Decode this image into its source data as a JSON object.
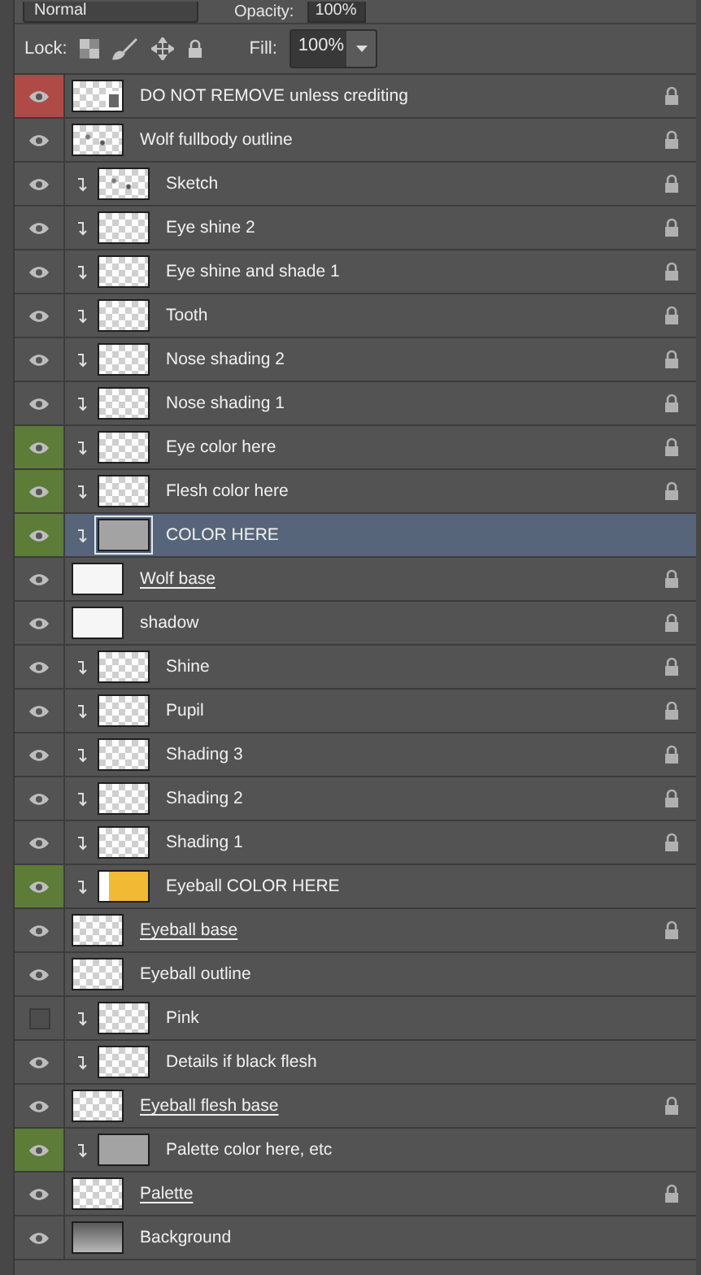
{
  "blend_mode": {
    "value": "Normal"
  },
  "opacity": {
    "label": "Opacity:",
    "value": "100%"
  },
  "lock": {
    "label": "Lock:"
  },
  "fill": {
    "label": "Fill:",
    "value": "100%"
  },
  "layers": [
    {
      "name": "DO NOT REMOVE unless crediting",
      "visible": true,
      "color": "#b04a46",
      "clipped": false,
      "locked": true,
      "underlined": false,
      "kind": "smart",
      "selected": false
    },
    {
      "name": "Wolf fullbody outline",
      "visible": true,
      "clipped": false,
      "locked": true,
      "underlined": false,
      "kind": "sketch",
      "selected": false
    },
    {
      "name": "Sketch",
      "visible": true,
      "clipped": true,
      "locked": true,
      "underlined": false,
      "kind": "sketch",
      "selected": false
    },
    {
      "name": "Eye shine 2",
      "visible": true,
      "clipped": true,
      "locked": true,
      "underlined": false,
      "kind": "checker",
      "selected": false
    },
    {
      "name": "Eye shine and shade 1",
      "visible": true,
      "clipped": true,
      "locked": true,
      "underlined": false,
      "kind": "checker",
      "selected": false
    },
    {
      "name": "Tooth",
      "visible": true,
      "clipped": true,
      "locked": true,
      "underlined": false,
      "kind": "checker",
      "selected": false
    },
    {
      "name": "Nose shading 2",
      "visible": true,
      "clipped": true,
      "locked": true,
      "underlined": false,
      "kind": "checker",
      "selected": false
    },
    {
      "name": "Nose shading 1",
      "visible": true,
      "clipped": true,
      "locked": true,
      "underlined": false,
      "kind": "checker",
      "selected": false
    },
    {
      "name": "Eye color here",
      "visible": true,
      "color": "#5d7c37",
      "clipped": true,
      "locked": true,
      "underlined": false,
      "kind": "checker",
      "selected": false
    },
    {
      "name": "Flesh color here",
      "visible": true,
      "color": "#5d7c37",
      "clipped": true,
      "locked": true,
      "underlined": false,
      "kind": "checker",
      "selected": false
    },
    {
      "name": "COLOR HERE",
      "visible": true,
      "color": "#5d7c37",
      "clipped": true,
      "locked": false,
      "underlined": false,
      "kind": "gray",
      "selected": true
    },
    {
      "name": "Wolf base",
      "visible": true,
      "clipped": false,
      "locked": true,
      "underlined": true,
      "kind": "white",
      "selected": false
    },
    {
      "name": "shadow",
      "visible": true,
      "clipped": false,
      "locked": true,
      "underlined": false,
      "kind": "white",
      "selected": false
    },
    {
      "name": "Shine",
      "visible": true,
      "clipped": true,
      "locked": true,
      "underlined": false,
      "kind": "checker",
      "selected": false
    },
    {
      "name": "Pupil",
      "visible": true,
      "clipped": true,
      "locked": true,
      "underlined": false,
      "kind": "checker",
      "selected": false
    },
    {
      "name": "Shading 3",
      "visible": true,
      "clipped": true,
      "locked": true,
      "underlined": false,
      "kind": "checker",
      "selected": false
    },
    {
      "name": "Shading 2",
      "visible": true,
      "clipped": true,
      "locked": true,
      "underlined": false,
      "kind": "checker",
      "selected": false
    },
    {
      "name": "Shading 1",
      "visible": true,
      "clipped": true,
      "locked": true,
      "underlined": false,
      "kind": "checker",
      "selected": false
    },
    {
      "name": "Eyeball COLOR HERE",
      "visible": true,
      "color": "#5d7c37",
      "clipped": true,
      "locked": false,
      "underlined": false,
      "kind": "yellow",
      "selected": false
    },
    {
      "name": "Eyeball base",
      "visible": true,
      "clipped": false,
      "locked": true,
      "underlined": true,
      "kind": "checker",
      "selected": false
    },
    {
      "name": "Eyeball outline",
      "visible": true,
      "clipped": false,
      "locked": false,
      "underlined": false,
      "kind": "checker",
      "selected": false
    },
    {
      "name": "Pink",
      "visible": false,
      "clipped": true,
      "locked": false,
      "underlined": false,
      "kind": "checker",
      "selected": false
    },
    {
      "name": "Details if black flesh",
      "visible": true,
      "clipped": true,
      "locked": false,
      "underlined": false,
      "kind": "checker",
      "selected": false
    },
    {
      "name": "Eyeball flesh base",
      "visible": true,
      "clipped": false,
      "locked": true,
      "underlined": true,
      "kind": "checker",
      "selected": false
    },
    {
      "name": "Palette color here, etc",
      "visible": true,
      "color": "#5d7c37",
      "clipped": true,
      "locked": false,
      "underlined": false,
      "kind": "gray",
      "selected": false
    },
    {
      "name": "Palette",
      "visible": true,
      "clipped": false,
      "locked": true,
      "underlined": true,
      "kind": "checker",
      "selected": false
    },
    {
      "name": "Background",
      "visible": true,
      "clipped": false,
      "locked": false,
      "underlined": false,
      "kind": "gradient",
      "selected": false
    }
  ]
}
